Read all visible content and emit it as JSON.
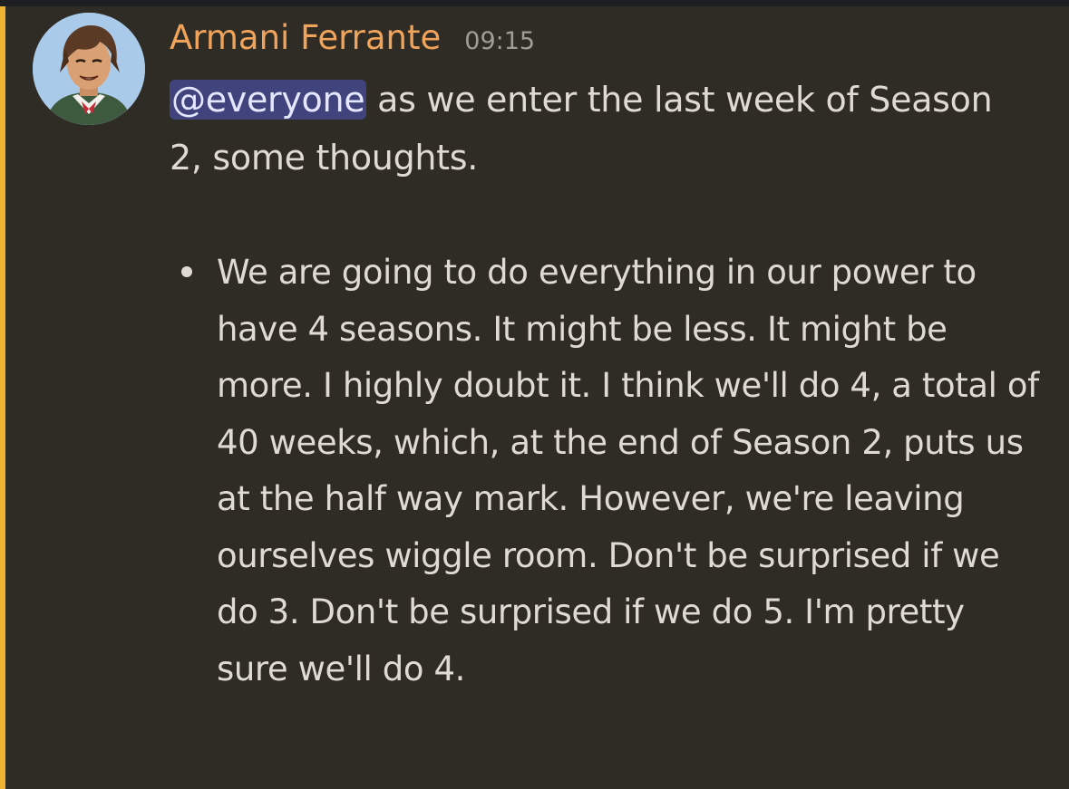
{
  "message": {
    "author": "Armani Ferrante",
    "timestamp": "09:15",
    "mention": "@everyone",
    "intro": " as we enter the last week of Season 2, some thoughts.",
    "bullets": [
      "We are going to do everything in our power to have 4 seasons. It might be less. It might be more. I highly doubt it. I think we'll do 4, a total of 40 weeks, which, at the end of Season 2, puts us at the half way mark. However, we're leaving ourselves wiggle room. Don't be surprised if we do 3. Don't be surprised if we do 5. I'm pretty sure we'll do 4."
    ]
  },
  "colors": {
    "background": "#2f2c26",
    "highlight_bar": "#f0b232",
    "author": "#f0a35a",
    "mention_bg": "#4c4f8f",
    "text": "#dfdbd3",
    "timestamp": "#a09c96"
  },
  "icons": {
    "avatar": "anime-style-portrait-avatar"
  }
}
